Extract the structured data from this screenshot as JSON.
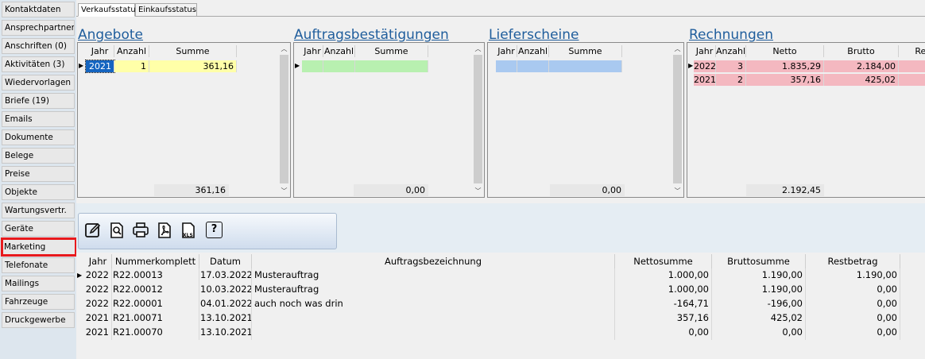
{
  "sidebar": {
    "items": [
      {
        "label": "Kontaktdaten"
      },
      {
        "label": "Ansprechpartner ..."
      },
      {
        "label": "Anschriften (0)"
      },
      {
        "label": "Aktivitäten (3)"
      },
      {
        "label": "Wiedervorlagen (0)"
      },
      {
        "label": "Briefe (19)"
      },
      {
        "label": "Emails"
      },
      {
        "label": "Dokumente"
      },
      {
        "label": "Belege"
      },
      {
        "label": "Preise"
      },
      {
        "label": "Objekte"
      },
      {
        "label": "Wartungsvertr."
      },
      {
        "label": "Geräte"
      },
      {
        "label": "Marketing"
      },
      {
        "label": "Telefonate"
      },
      {
        "label": "Mailings"
      },
      {
        "label": "Fahrzeuge"
      },
      {
        "label": "Druckgewerbe"
      }
    ],
    "highlighted": "Marketing"
  },
  "tabs": [
    {
      "label": "Verkaufsstatus"
    },
    {
      "label": "Einkaufsstatus"
    }
  ],
  "panels": {
    "angebote": {
      "title": "Angebote",
      "headers": [
        "Jahr",
        "Anzahl",
        "Summe"
      ],
      "rows": [
        [
          "2021",
          "1",
          "361,16"
        ]
      ],
      "total": "361,16"
    },
    "auftrag": {
      "title": "Auftragsbestätigungen",
      "headers": [
        "Jahr",
        "Anzahl",
        "Summe"
      ],
      "total": "0,00"
    },
    "liefer": {
      "title": "Lieferscheine",
      "headers": [
        "Jahr",
        "Anzahl",
        "Summe"
      ],
      "total": "0,00"
    },
    "rechnungen": {
      "title": "Rechnungen",
      "headers": [
        "Jahr",
        "Anzahl",
        "Netto",
        "Brutto",
        "Res"
      ],
      "rows": [
        [
          "2022",
          "3",
          "1.835,29",
          "2.184,00"
        ],
        [
          "2021",
          "2",
          "357,16",
          "425,02"
        ]
      ],
      "total": "2.192,45"
    }
  },
  "toolbar": {
    "icons": [
      "edit-icon",
      "search-document-icon",
      "print-icon",
      "pdf-icon",
      "xls-icon",
      "help-icon"
    ],
    "xls_label": "XLS",
    "help_label": "?"
  },
  "grid": {
    "headers": [
      "Jahr",
      "Nummerkomplett",
      "Datum",
      "Auftragsbezeichnung",
      "Nettosumme",
      "Bruttosumme",
      "Restbetrag"
    ],
    "rows": [
      {
        "jahr": "2022",
        "nummer": "R22.00013",
        "datum": "17.03.2022",
        "bez": "Musterauftrag",
        "netto": "1.000,00",
        "brutto": "1.190,00",
        "rest": "1.190,00"
      },
      {
        "jahr": "2022",
        "nummer": "R22.00012",
        "datum": "10.03.2022",
        "bez": "Musterauftrag",
        "netto": "1.000,00",
        "brutto": "1.190,00",
        "rest": "0,00"
      },
      {
        "jahr": "2022",
        "nummer": "R22.00001",
        "datum": "04.01.2022",
        "bez": "auch noch was drin",
        "netto": "-164,71",
        "brutto": "-196,00",
        "rest": "0,00"
      },
      {
        "jahr": "2021",
        "nummer": "R21.00071",
        "datum": "13.10.2021",
        "bez": "",
        "netto": "357,16",
        "brutto": "425,02",
        "rest": "0,00"
      },
      {
        "jahr": "2021",
        "nummer": "R21.00070",
        "datum": "13.10.2021",
        "bez": "",
        "netto": "0,00",
        "brutto": "0,00",
        "rest": "0,00"
      }
    ]
  },
  "colors": {
    "highlight_border": "#e8191c",
    "title_blue": "#1f5d9c",
    "angebote_row": "#ffffa8",
    "auftrag_row": "#b8f0b0",
    "liefer_row": "#a9c9f0",
    "rechnungen_row": "#f4b8c0",
    "selected_cell": "#1565c0"
  }
}
